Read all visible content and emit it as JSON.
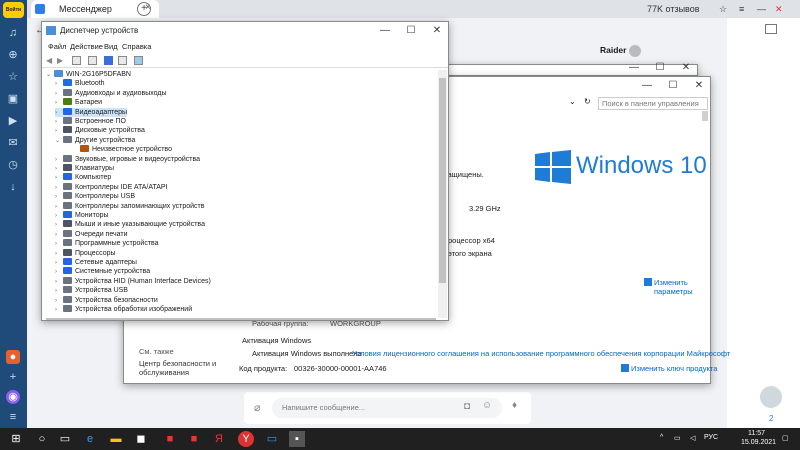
{
  "browser": {
    "logo_text": "Войти",
    "tab_title": "Мессенджер",
    "tab_close": "×",
    "new_tab": "+",
    "reviews": "77K отзывов",
    "user_name": "Raider"
  },
  "device_manager": {
    "title": "Диспетчер устройств",
    "menu": [
      "Файл",
      "Действие",
      "Вид",
      "Справка"
    ],
    "computer": "WIN-2G16P5DFABN",
    "items": [
      {
        "label": "Bluetooth",
        "expanded": false,
        "child": false,
        "color": "#1e6fd9"
      },
      {
        "label": "Аудиовходы и аудиовыходы",
        "expanded": false,
        "child": false,
        "color": "#6b7280"
      },
      {
        "label": "Батареи",
        "expanded": false,
        "child": false,
        "color": "#4d7c0f"
      },
      {
        "label": "Видеоадаптеры",
        "expanded": false,
        "child": false,
        "color": "#2563eb",
        "selected": true
      },
      {
        "label": "Встроенное ПО",
        "expanded": false,
        "child": false,
        "color": "#6b7280"
      },
      {
        "label": "Дисковые устройства",
        "expanded": false,
        "child": false,
        "color": "#4b5563"
      },
      {
        "label": "Другие устройства",
        "expanded": true,
        "child": false,
        "color": "#6b7280"
      },
      {
        "label": "Неизвестное устройство",
        "expanded": false,
        "child": true,
        "color": "#b45309"
      },
      {
        "label": "Звуковые, игровые и видеоустройства",
        "expanded": false,
        "child": false,
        "color": "#6b7280"
      },
      {
        "label": "Клавиатуры",
        "expanded": false,
        "child": false,
        "color": "#4b5563"
      },
      {
        "label": "Компьютер",
        "expanded": false,
        "child": false,
        "color": "#2563eb"
      },
      {
        "label": "Контроллеры IDE ATA/ATAPI",
        "expanded": false,
        "child": false,
        "color": "#6b7280"
      },
      {
        "label": "Контроллеры USB",
        "expanded": false,
        "child": false,
        "color": "#6b7280"
      },
      {
        "label": "Контроллеры запоминающих устройств",
        "expanded": false,
        "child": false,
        "color": "#6b7280"
      },
      {
        "label": "Мониторы",
        "expanded": false,
        "child": false,
        "color": "#2563eb"
      },
      {
        "label": "Мыши и иные указывающие устройства",
        "expanded": false,
        "child": false,
        "color": "#4b5563"
      },
      {
        "label": "Очереди печати",
        "expanded": false,
        "child": false,
        "color": "#6b7280"
      },
      {
        "label": "Программные устройства",
        "expanded": false,
        "child": false,
        "color": "#6b7280"
      },
      {
        "label": "Процессоры",
        "expanded": false,
        "child": false,
        "color": "#4b5563"
      },
      {
        "label": "Сетевые адаптеры",
        "expanded": false,
        "child": false,
        "color": "#2563eb"
      },
      {
        "label": "Системные устройства",
        "expanded": false,
        "child": false,
        "color": "#2563eb"
      },
      {
        "label": "Устройства HID (Human Interface Devices)",
        "expanded": false,
        "child": false,
        "color": "#6b7280"
      },
      {
        "label": "Устройства USB",
        "expanded": false,
        "child": false,
        "color": "#6b7280"
      },
      {
        "label": "Устройства безопасности",
        "expanded": false,
        "child": false,
        "color": "#6b7280"
      },
      {
        "label": "Устройства обработки изображений",
        "expanded": false,
        "child": false,
        "color": "#6b7280"
      }
    ]
  },
  "system": {
    "search_placeholder": "Поиск в панели управления",
    "protected": "защищены.",
    "windows_logo": "Windows 10",
    "cpu_freq": "3.29 GHz",
    "processor": "роцессор x64",
    "screen": "этого экрана",
    "change_params": "Изменить параметры",
    "workgroup_label": "Рабочая группа:",
    "workgroup": "WORKGROUP",
    "see_also": "См. также",
    "security_center": "Центр безопасности и обслуживания",
    "activation_header": "Активация Windows",
    "activation_status": "Активация Windows выполнена",
    "license_link": "Условия лицензионного соглашения на использование программного обеспечения корпорации Майкрософт",
    "product_code_label": "Код продукта:",
    "product_code": "00326-30000-00001-AA746",
    "change_key": "Изменить ключ продукта"
  },
  "messenger": {
    "input_placeholder": "Напишите сообщение...",
    "badge": "2"
  },
  "taskbar": {
    "lang": "РУС",
    "time": "11:57",
    "date": "15.09.2021"
  },
  "colors": {
    "accent": "#0066cc",
    "selection": "#cce4f7",
    "taskbar": "#202020"
  }
}
